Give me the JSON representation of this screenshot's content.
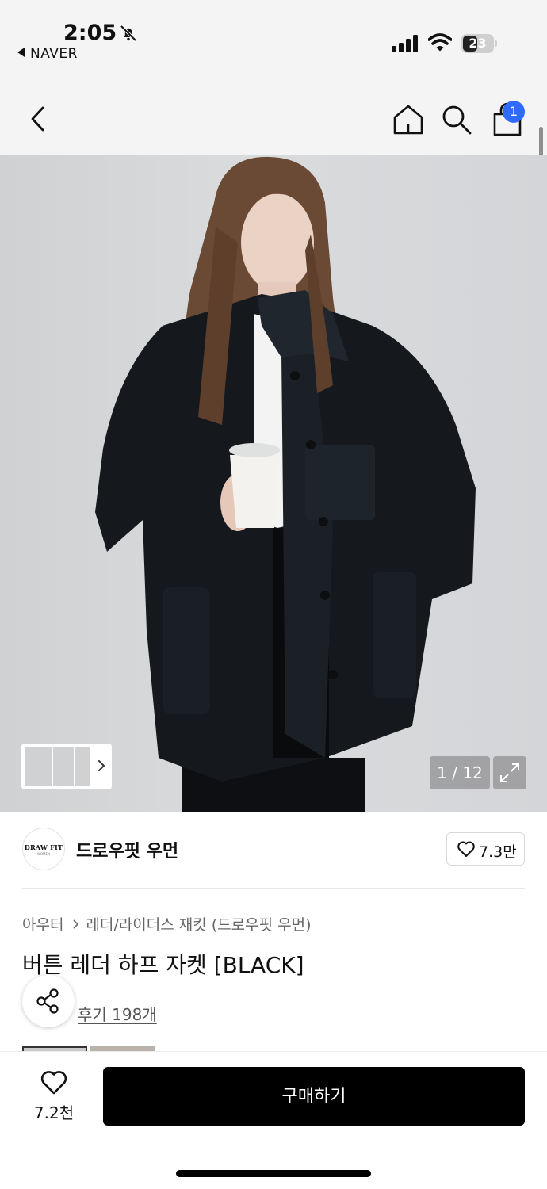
{
  "status_bar": {
    "time": "2:05",
    "back_app": "NAVER",
    "battery": "23",
    "icons": [
      "bell-slash-icon",
      "cellular-signal-icon",
      "wifi-icon",
      "battery-icon"
    ]
  },
  "header": {
    "icons": [
      "back-chevron-icon",
      "home-icon",
      "search-icon",
      "shopping-bag-icon"
    ],
    "cart_badge": "1"
  },
  "gallery": {
    "counter": "1 / 12",
    "icons": [
      "expand-icon",
      "chevron-right-icon"
    ]
  },
  "brand": {
    "logo_line1": "DRAW FIT",
    "logo_line2": "WOMEN",
    "name": "드로우핏 우먼",
    "like_count": "7.3만"
  },
  "product": {
    "category_parent": "아우터",
    "category_child": "레더/라이더스 재킷 (드로우핏 우먼)",
    "title": "버튼 레더 하프 자켓 [BLACK]",
    "reviews": "후기 198개"
  },
  "bottom_bar": {
    "wish_count": "7.2천",
    "buy_label": "구매하기"
  },
  "colors": {
    "accent_badge": "#2f6bff",
    "buy_button": "#000000",
    "header_bg": "#f4f4f4"
  }
}
